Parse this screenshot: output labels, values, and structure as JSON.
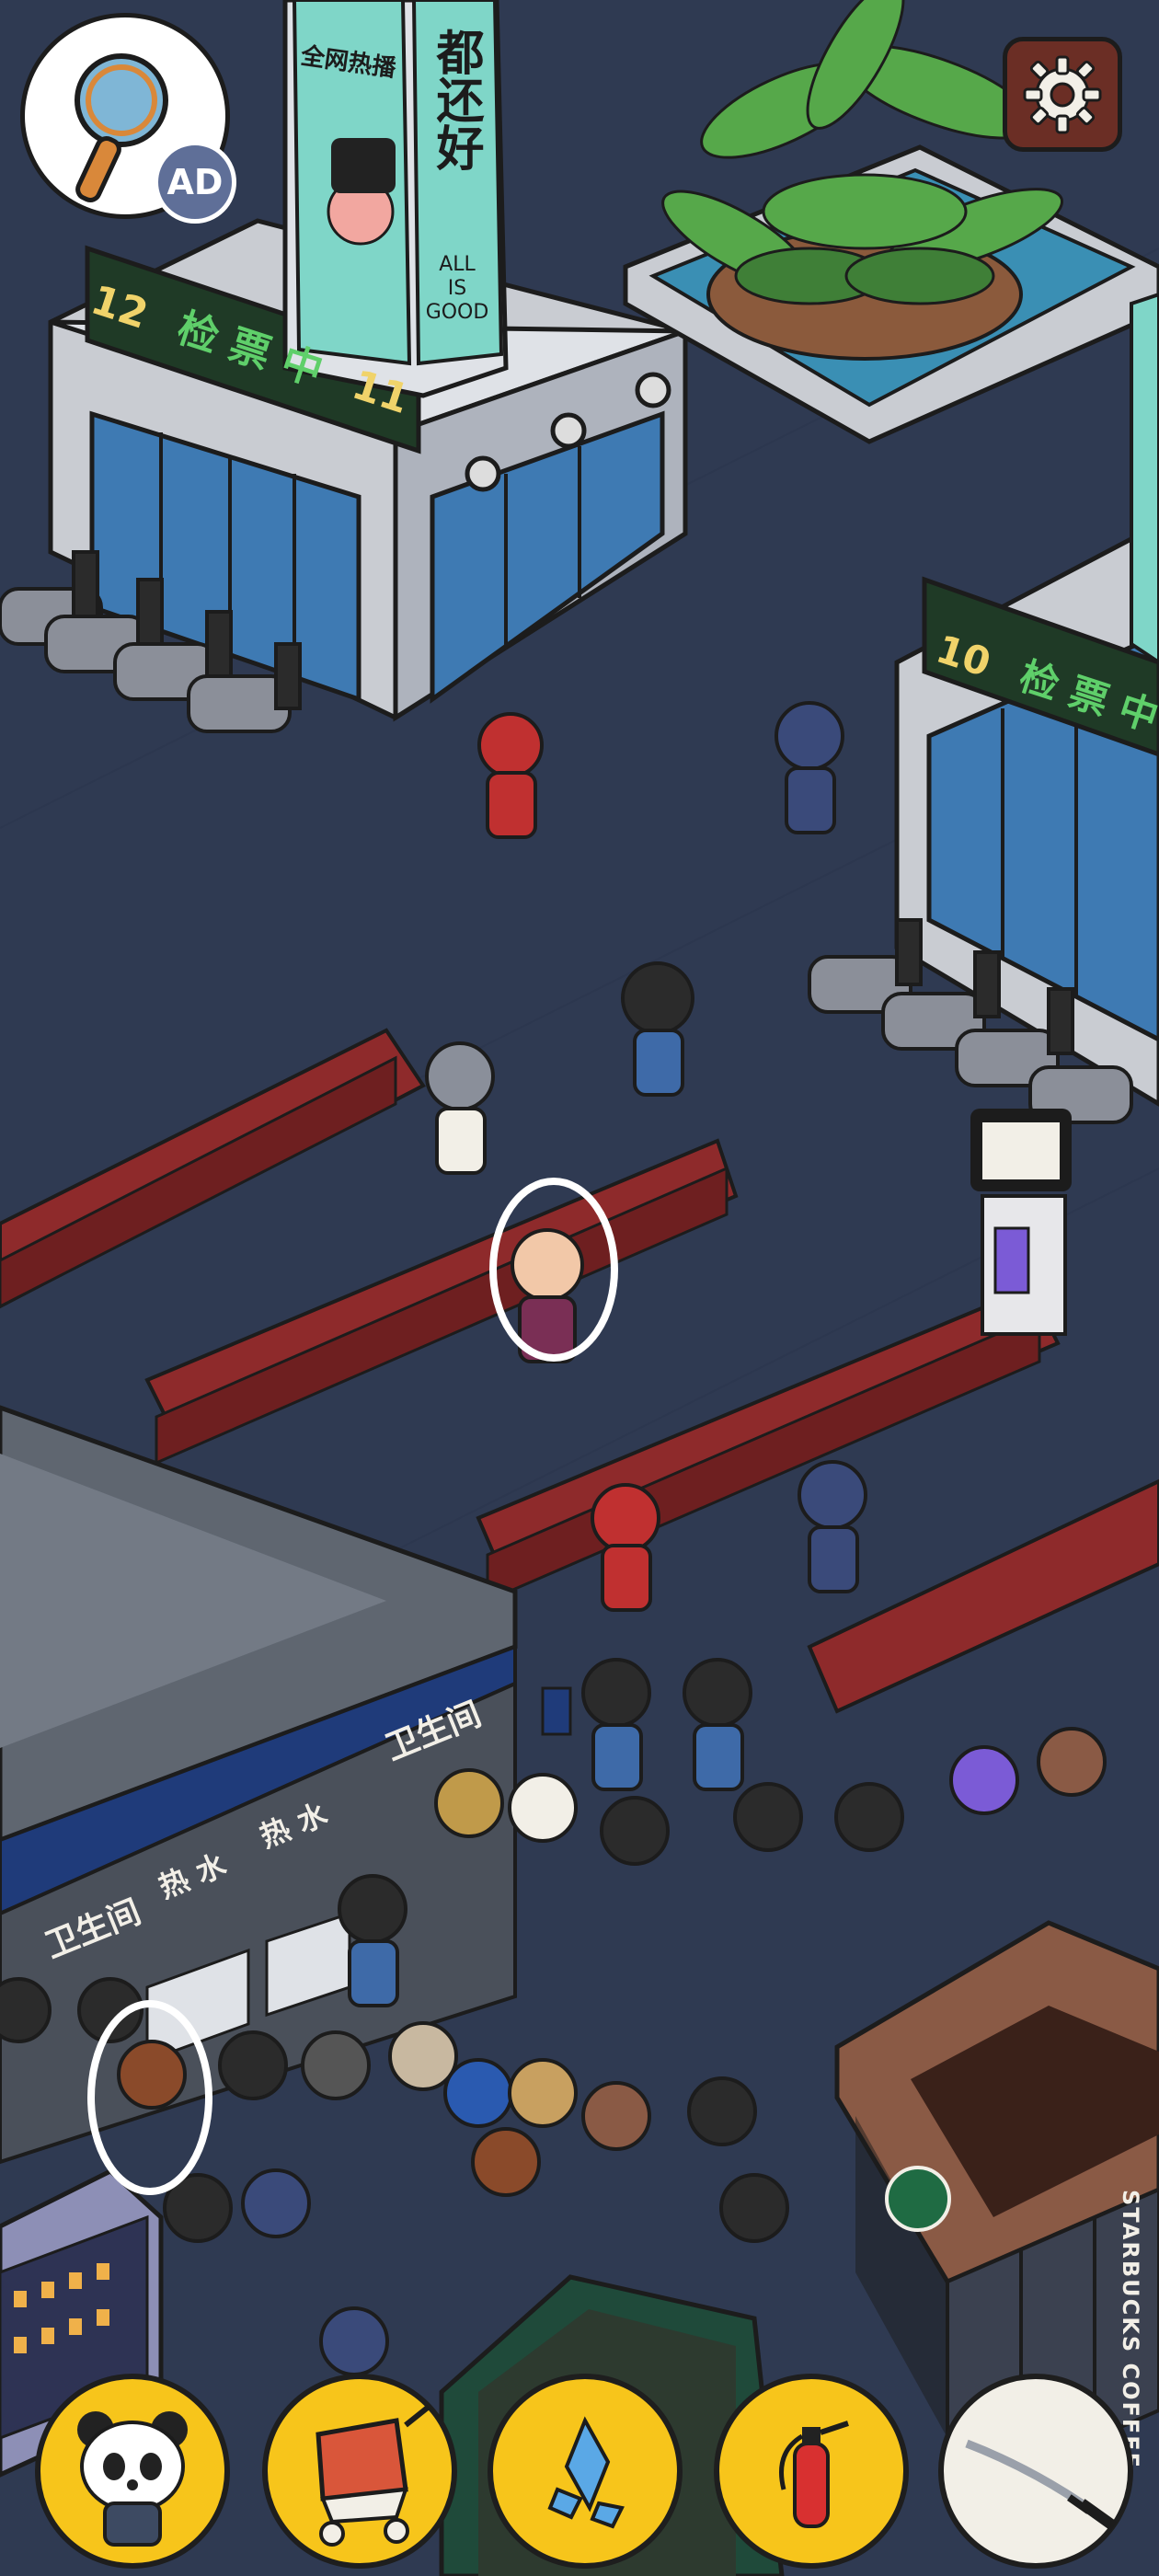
{
  "game": {
    "scene": "train-station-waiting-hall",
    "found_marker_color": "#ffffff"
  },
  "hud": {
    "hint_badge": "AD",
    "hint_icon": "magnifier-icon",
    "settings_icon": "gear-icon"
  },
  "signs": {
    "gate_12_number": "12",
    "gate_12_text": "检 票 中",
    "gate_12_next": "11",
    "gate_10_number": "10",
    "gate_10_text": "检 票 中",
    "pillar_title": "全网热播",
    "pillar_banner": "都还好",
    "pillar_subtitle_1": "ALL",
    "pillar_subtitle_2": "IS",
    "pillar_subtitle_3": "GOOD",
    "restroom": "卫生间",
    "hot_water": "热 水",
    "coffee_shop": "STARBUCKS COFFEE"
  },
  "toolbar": {
    "items": [
      {
        "name": "panda-character",
        "icon": "panda-icon"
      },
      {
        "name": "stroller",
        "icon": "stroller-icon"
      },
      {
        "name": "crystal",
        "icon": "crystal-icon"
      },
      {
        "name": "fire-extinguisher",
        "icon": "extinguisher-icon"
      },
      {
        "name": "katana",
        "icon": "katana-icon"
      }
    ],
    "active_bg": "#f7c51b",
    "inactive_bg": "#f2efe7"
  },
  "colors": {
    "floor": "#2f3a52",
    "seat": "#8e2a2b",
    "gate_sign": "#1f3a26",
    "sign_text": "#f0d36a",
    "restroom_sign": "#1f3b7a"
  }
}
